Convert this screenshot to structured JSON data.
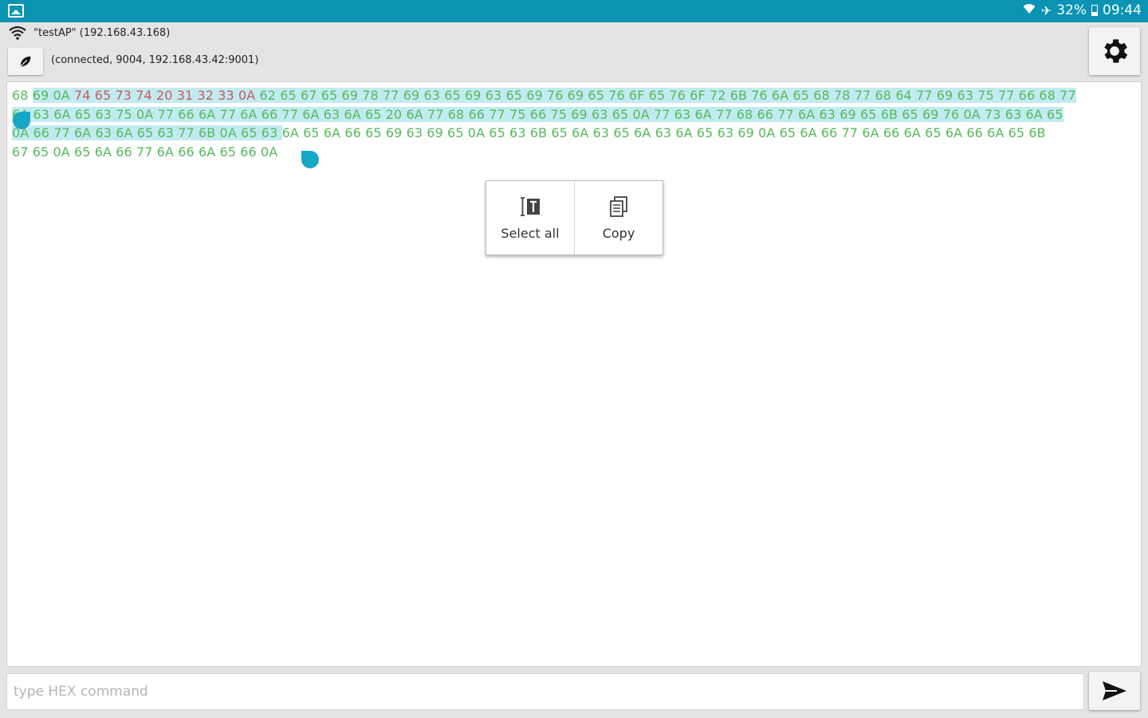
{
  "status_bar": {
    "battery": "32%",
    "time": "09:44",
    "icons": [
      "gallery-icon",
      "wifi-icon",
      "airplane-mode-icon",
      "battery-icon"
    ]
  },
  "connection": {
    "wifi_label": "\"testAP\" (192.168.43.168)",
    "status_text": "(connected, 9004, 192.168.43.42:9001)"
  },
  "terminal": {
    "lines": [
      [
        {
          "t": "68 ",
          "c": "g",
          "hl": false
        },
        {
          "t": "69 0A ",
          "c": "g",
          "hl": true
        },
        {
          "t": "74 65 73 74 20 31 32 33 0A ",
          "c": "r",
          "hl": true
        },
        {
          "t": "62 65 67 65 69 78 77 69 63 65 69 63 65 69 76 69 65 76 6F 65 76 6F 72 6B 76 6A 65 68 78 77 68 64 77 69 63 75 77 66 68 77",
          "c": "g",
          "hl": true
        }
      ],
      [
        {
          "t": "6A 63 6A 65 63 75 0A 77 66 6A 77 6A 66 77 6A 63 6A 65 20 6A 77 68 66 77 75 66 75 69 63 65 0A 77 63 6A 77 68 66 77 6A 63 69 65 6B 65 69 76 0A 73 63 6A 65",
          "c": "g",
          "hl": true
        }
      ],
      [
        {
          "t": "0A 66 77 6A 63 6A 65 63 77 6B 0A 65 63 ",
          "c": "g",
          "hl": true
        },
        {
          "t": "6A 65 6A 66 65 69 63 69 65 0A 65 63 6B 65 6A 63 65 6A 63 6A 65 63 69 0A 65 6A 66 77 6A 66 6A 65 6A 66 6A 65 6B",
          "c": "g",
          "hl": false
        }
      ],
      [
        {
          "t": "67 65 0A 65 6A 66 77 6A 66 6A 65 66 0A",
          "c": "g",
          "hl": false
        }
      ]
    ]
  },
  "context_menu": {
    "select_all": "Select all",
    "copy": "Copy"
  },
  "input": {
    "placeholder": "type HEX command",
    "value": ""
  },
  "colors": {
    "status_bar": "#0a93b3",
    "hex_green": "#55b95a",
    "hex_red": "#c75a5a",
    "selection": "#c2ebf1",
    "handle": "#16a6c7"
  }
}
